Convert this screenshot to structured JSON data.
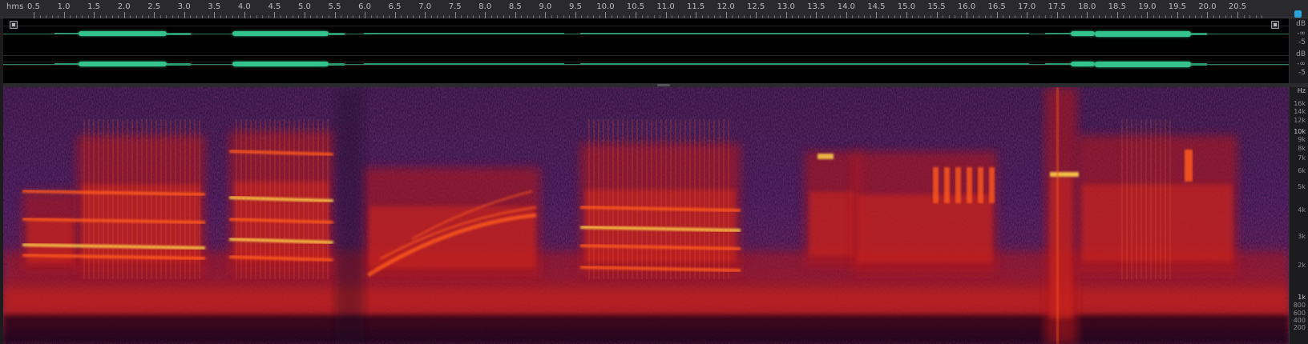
{
  "ruler": {
    "unit": "hms",
    "ticks": [
      "0.5",
      "1.0",
      "1.5",
      "2.0",
      "2.5",
      "3.0",
      "3.5",
      "4.0",
      "4.5",
      "5.0",
      "5.5",
      "6.0",
      "6.5",
      "7.0",
      "7.5",
      "8.0",
      "8.5",
      "9.0",
      "9.5",
      "10.0",
      "10.5",
      "11.0",
      "11.5",
      "12.0",
      "12.5",
      "13.0",
      "13.5",
      "14.0",
      "14.5",
      "15.0",
      "15.5",
      "16.0",
      "16.5",
      "17.0",
      "17.5",
      "18.0",
      "18.5",
      "19.0",
      "19.5",
      "20.0",
      "20.5"
    ]
  },
  "overview": {
    "channel1_db": [
      "dB",
      "-∞",
      "-5"
    ],
    "channel2_db": [
      "dB",
      "-∞",
      "-5"
    ],
    "colors": {
      "waveform": "#34c28d",
      "background": "#000000"
    }
  },
  "spectrogram": {
    "unit": "Hz",
    "freq_labels": [
      "16k",
      "14k",
      "12k",
      "10k",
      "9k",
      "8k",
      "7k",
      "6k",
      "5k",
      "4k",
      "3k",
      "2k",
      "1k",
      "800",
      "600",
      "400",
      "200"
    ],
    "colors": {
      "low": "#1a0b2e",
      "mid": "#b0121b",
      "high": "#ff5a1a",
      "peak": "#ffd24a"
    }
  }
}
